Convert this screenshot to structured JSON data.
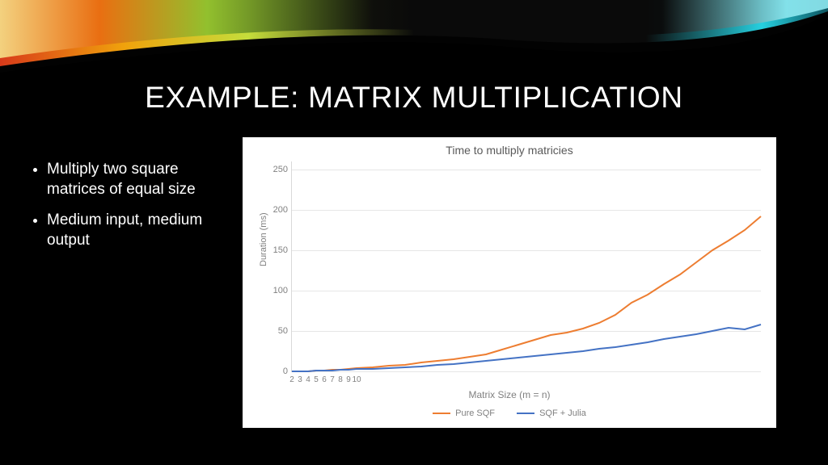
{
  "title": "EXAMPLE: MATRIX MULTIPLICATION",
  "bullets": [
    "Multiply two square matrices of equal size",
    "Medium input, medium output"
  ],
  "chart_data": {
    "type": "line",
    "title": "Time to multiply matricies",
    "xlabel": "Matrix Size (m = n)",
    "ylabel": "Duration (ms)",
    "ylim": [
      0,
      260
    ],
    "yticks": [
      0,
      50,
      100,
      150,
      200,
      250
    ],
    "xticks": [
      2,
      3,
      4,
      5,
      6,
      7,
      8,
      9,
      10
    ],
    "x": [
      2,
      3,
      4,
      5,
      6,
      7,
      8,
      9,
      10,
      12,
      14,
      16,
      18,
      20,
      22,
      24,
      26,
      28,
      30,
      32,
      34,
      36,
      38,
      40,
      42,
      44,
      46,
      48,
      50,
      52,
      54,
      56,
      58,
      60
    ],
    "series": [
      {
        "name": "Pure SQF",
        "color": "#ED7D31",
        "values": [
          0,
          0,
          0,
          1,
          1,
          2,
          2,
          3,
          4,
          5,
          7,
          8,
          11,
          13,
          15,
          18,
          21,
          27,
          33,
          39,
          45,
          48,
          53,
          60,
          70,
          85,
          95,
          108,
          120,
          135,
          150,
          162,
          175,
          192
        ]
      },
      {
        "name": "SQF + Julia",
        "color": "#4472C4",
        "values": [
          0,
          0,
          0,
          1,
          1,
          1,
          2,
          2,
          3,
          3,
          4,
          5,
          6,
          8,
          9,
          11,
          13,
          15,
          17,
          19,
          21,
          23,
          25,
          28,
          30,
          33,
          36,
          40,
          43,
          46,
          50,
          54,
          52,
          58
        ]
      }
    ],
    "legend": [
      "Pure SQF",
      "SQF + Julia"
    ]
  }
}
